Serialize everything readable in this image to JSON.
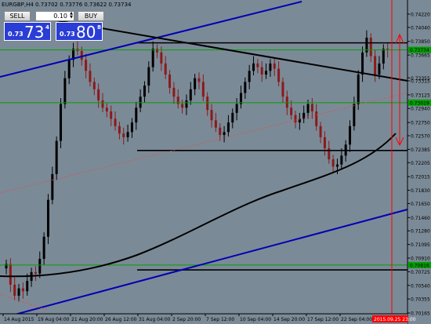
{
  "symbol_header": "EURGBP,H4  0.73702 0.73776 0.73622 0.73734",
  "trade_panel": {
    "sell_label": "SELL",
    "buy_label": "BUY",
    "lot": "0.10",
    "sell_small": "0.73",
    "sell_big": "73",
    "sell_sup": "4",
    "buy_small": "0.73",
    "buy_big": "80",
    "buy_sup": "8"
  },
  "colors": {
    "background": "#7b8a97",
    "bull": "#000000",
    "bear": "#8b1a1a",
    "trend_blue": "#0000b4",
    "level_green": "#00a000",
    "vline_red": "#ff0000",
    "ma_black": "#000000"
  },
  "chart_data": {
    "type": "candlestick",
    "ylim": [
      0.70165,
      0.7439
    ],
    "y_ticks": [
      "0.74220",
      "0.74040",
      "0.73850",
      "0.73665",
      "0.73355",
      "0.73315",
      "0.73125",
      "0.72940",
      "0.72750",
      "0.72570",
      "0.72385",
      "0.72205",
      "0.72015",
      "0.71830",
      "0.71650",
      "0.71460",
      "0.71280",
      "0.71095",
      "0.70910",
      "0.70725",
      "0.70540",
      "0.70355",
      "0.70165"
    ],
    "x_ticks": [
      "14 Aug 2015",
      "19 Aug 04:00",
      "21 Aug 20:00",
      "26 Aug 12:00",
      "31 Aug 04:00",
      "2 Sep 20:00",
      "7 Sep 12:00",
      "10 Sep 04:00",
      "14 Sep 20:00",
      "17 Sep 12:00",
      "22 Sep 04:00"
    ],
    "price_labels": [
      {
        "text": "0.73734",
        "value": 0.73734,
        "color": "#00a000"
      },
      {
        "text": "0.73019",
        "value": 0.73019,
        "color": "#00a000"
      },
      {
        "text": "0.70816",
        "value": 0.70816,
        "color": "#00a000"
      }
    ],
    "time_label": "2015.09.25 23:00",
    "horizontal_levels": [
      {
        "value": 0.73734,
        "color": "#00a000"
      },
      {
        "value": 0.73019,
        "color": "#00a000"
      },
      {
        "value": 0.70816,
        "color": "#00a000"
      },
      {
        "value": 0.7383,
        "color": "#000000"
      },
      {
        "value": 0.7237,
        "color": "#000000"
      },
      {
        "value": 0.7075,
        "color": "#000000"
      }
    ],
    "closes": [
      0.7083,
      0.7055,
      0.704,
      0.705,
      0.7046,
      0.706,
      0.7072,
      0.707,
      0.709,
      0.712,
      0.717,
      0.7205,
      0.725,
      0.73,
      0.7335,
      0.736,
      0.7375,
      0.7372,
      0.736,
      0.7345,
      0.733,
      0.732,
      0.7305,
      0.7295,
      0.729,
      0.728,
      0.727,
      0.726,
      0.7255,
      0.7262,
      0.7275,
      0.7295,
      0.731,
      0.7325,
      0.735,
      0.7375,
      0.737,
      0.7355,
      0.734,
      0.7322,
      0.731,
      0.73,
      0.7295,
      0.7305,
      0.732,
      0.7335,
      0.733,
      0.731,
      0.7292,
      0.7278,
      0.7268,
      0.7258,
      0.7262,
      0.7275,
      0.7288,
      0.73,
      0.7315,
      0.733,
      0.7345,
      0.7355,
      0.735,
      0.734,
      0.7345,
      0.7355,
      0.7348,
      0.733,
      0.731,
      0.7295,
      0.7285,
      0.7275,
      0.728,
      0.7288,
      0.73,
      0.729,
      0.727,
      0.7255,
      0.724,
      0.7225,
      0.7215,
      0.7218,
      0.723,
      0.7245,
      0.727,
      0.73,
      0.734,
      0.737,
      0.739,
      0.7365,
      0.734,
      0.7355,
      0.7375,
      0.7373
    ]
  }
}
